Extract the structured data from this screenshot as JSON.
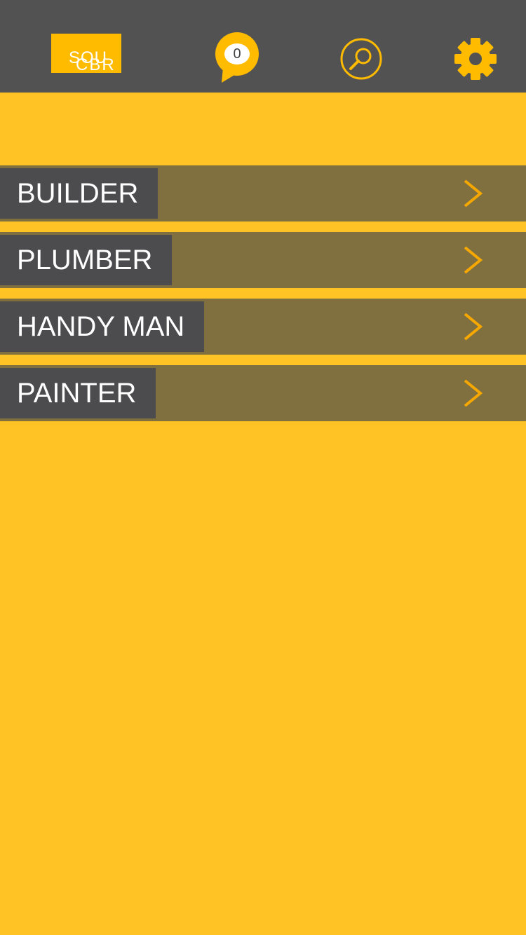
{
  "header": {
    "logo": {
      "line1": "SOU",
      "line2": "CBR"
    },
    "messages": {
      "count": "0",
      "icon": "chat-bubble-icon"
    },
    "search": {
      "icon": "search-icon"
    },
    "settings": {
      "icon": "gear-icon"
    }
  },
  "categories": [
    {
      "label": "BUILDER"
    },
    {
      "label": "PLUMBER"
    },
    {
      "label": "HANDY MAN"
    },
    {
      "label": "PAINTER"
    }
  ],
  "colors": {
    "background": "#ffc326",
    "topbar": "#525252",
    "row": "#80703f",
    "label_bg": "#4c4c4e",
    "accent": "#ffbb00",
    "chevron": "#f7a800"
  }
}
